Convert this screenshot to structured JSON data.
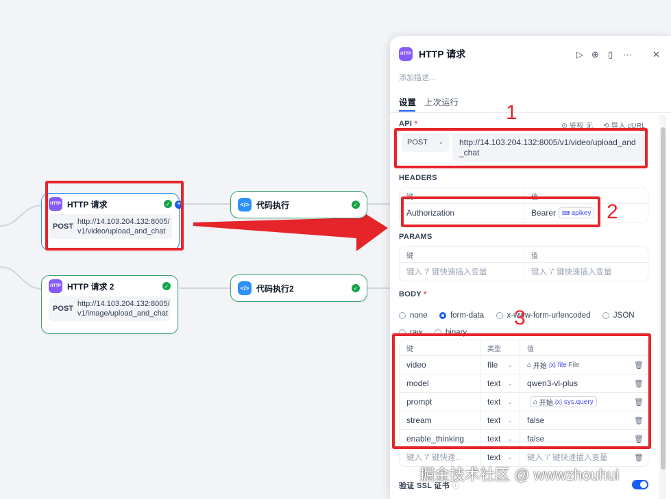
{
  "nodes": {
    "http1": {
      "title": "HTTP 请求",
      "icon_text": "HTTP",
      "method": "POST",
      "url": "http://14.103.204.132:8005/\nv1/video/upload_and_chat"
    },
    "code1": {
      "title": "代码执行"
    },
    "http2": {
      "title": "HTTP 请求 2",
      "icon_text": "HTTP",
      "method": "POST",
      "url": "http://14.103.204.132:8005/\nv1/image/upload_and_chat"
    },
    "code2": {
      "title": "代码执行2"
    }
  },
  "annotations": {
    "n1": "1",
    "n2": "2",
    "n3": "3"
  },
  "panel": {
    "icon_text": "HTTP",
    "title": "HTTP 请求",
    "description_placeholder": "添加描述...",
    "tabs": [
      "设置",
      "上次运行"
    ],
    "api": {
      "label": "API",
      "required": "*",
      "auth": "鉴权 无",
      "import": "导入 cURL",
      "method": "POST",
      "url": "http://14.103.204.132:8005/v1/video/upload_and_chat"
    },
    "headers": {
      "label": "HEADERS",
      "col_key": "键",
      "col_value": "值",
      "row": {
        "key": "Authorization",
        "value_prefix": "Bearer",
        "value_var": "apikey"
      }
    },
    "params": {
      "label": "PARAMS",
      "col_key": "键",
      "col_value": "值",
      "key_placeholder": "键入 '/' 键快速插入变量",
      "value_placeholder": "键入 '/' 键快速插入变量"
    },
    "body": {
      "label": "BODY",
      "required": "*",
      "options": [
        "none",
        "form-data",
        "x-www-form-urlencoded",
        "JSON",
        "raw",
        "binary"
      ],
      "selected": "form-data",
      "col_key": "键",
      "col_type": "类型",
      "col_value": "值",
      "rows": [
        {
          "key": "video",
          "type": "file",
          "value": "",
          "var_node": "开始",
          "var_name": "file",
          "var_type": "File"
        },
        {
          "key": "model",
          "type": "text",
          "value": "qwen3-vl-plus"
        },
        {
          "key": "prompt",
          "type": "text",
          "value": "",
          "var_node": "开始",
          "var_name": "sys.query"
        },
        {
          "key": "stream",
          "type": "text",
          "value": "false"
        },
        {
          "key": "enable_thinking",
          "type": "text",
          "value": "false"
        }
      ],
      "new_row": {
        "key_placeholder": "键入 '/' 键快速...",
        "type": "text",
        "value_placeholder": "键入 '/' 键快速插入变量"
      }
    },
    "ssl": {
      "label": "验证 SSL 证书"
    }
  },
  "watermark": "掘金技术社区 @ wwwzhouhui"
}
